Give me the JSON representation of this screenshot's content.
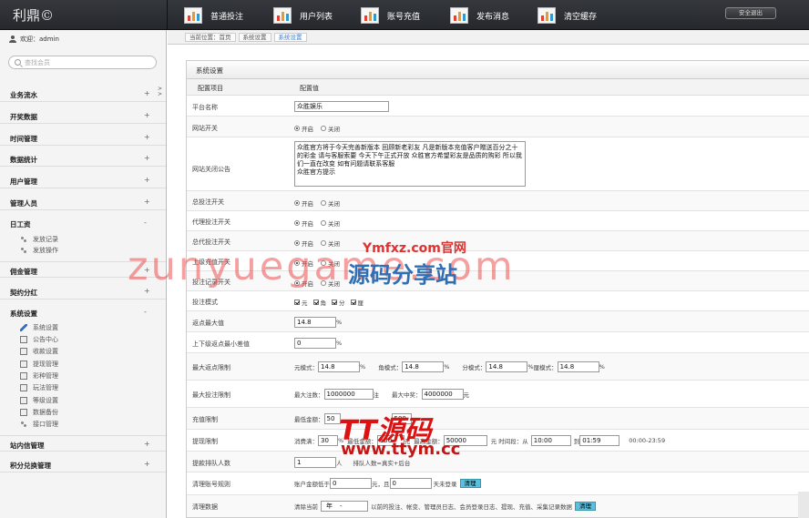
{
  "app": {
    "logo": "利鼎©",
    "logout": "安全退出"
  },
  "nav": [
    {
      "label": "普通投注"
    },
    {
      "label": "用户列表"
    },
    {
      "label": "账号充值"
    },
    {
      "label": "发布消息"
    },
    {
      "label": "清空缓存"
    }
  ],
  "sidebar": {
    "welcome": "欢迎：admin",
    "search_placeholder": "查找会员",
    "sections": [
      {
        "label": "业务流水",
        "toggle": "+"
      },
      {
        "label": "开奖数据",
        "toggle": "+"
      },
      {
        "label": "时间管理",
        "toggle": "+"
      },
      {
        "label": "数据统计",
        "toggle": "+"
      },
      {
        "label": "用户管理",
        "toggle": "+"
      },
      {
        "label": "管理人员",
        "toggle": "+"
      },
      {
        "label": "日工资",
        "toggle": "-"
      },
      {
        "label": "佣金管理",
        "toggle": "+"
      },
      {
        "label": "契约分红",
        "toggle": "+"
      },
      {
        "label": "系统设置",
        "toggle": "-"
      },
      {
        "label": "站内信管理",
        "toggle": "+"
      },
      {
        "label": "积分兑换管理",
        "toggle": "+"
      }
    ],
    "wage_items": [
      "发放记录",
      "发放操作"
    ],
    "system_items": [
      "系统设置",
      "公告中心",
      "收款设置",
      "提现管理",
      "彩种管理",
      "玩法管理",
      "等级设置",
      "数据备份",
      "接口管理"
    ]
  },
  "breadcrumb": {
    "items": [
      "当前位置：首页",
      "系统设置",
      "系统设置"
    ]
  },
  "panel": {
    "title": "系统设置",
    "col1": "配置项目",
    "col2": "配置值"
  },
  "common": {
    "on": "开启",
    "off": "关闭"
  },
  "rows": {
    "site_name": {
      "label": "平台名称",
      "value": "众胜娱乐"
    },
    "site_switch": {
      "label": "网站开关"
    },
    "close_notice": {
      "label": "网站关闭公告",
      "value": "众胜官方将于今天完善新版本 回顾新老彩友 凡是新版本充值客户赠送百分之十的彩金 请与客服索要 今天下午正式开放 众胜官方希望彩友是品质的购彩 所以我们一直在改变 如有问题请联系客服\n众胜官方提示"
    },
    "bet_switch": {
      "label": "总投注开关"
    },
    "agent_bet_switch": {
      "label": "代理投注开关"
    },
    "gen_agent_bet_switch": {
      "label": "总代投注开关"
    },
    "upper_recharge_switch": {
      "label": "上级充值开关"
    },
    "bet_record_switch": {
      "label": "投注记录开关"
    },
    "bet_mode": {
      "label": "投注模式",
      "options": [
        "元",
        "角",
        "分",
        "厘"
      ]
    },
    "rebate_max": {
      "label": "返点最大值",
      "value": "14.8",
      "unit": "%"
    },
    "rebate_min_diff": {
      "label": "上下级返点最小差值",
      "value": "0",
      "unit": "%"
    },
    "max_rebate_limit": {
      "label": "最大返点限制",
      "items": [
        {
          "label": "元模式：",
          "value": "14.8",
          "unit": "%"
        },
        {
          "label": "角模式：",
          "value": "14.8",
          "unit": "%"
        },
        {
          "label": "分模式：",
          "value": "14.8",
          "unit": "%"
        },
        {
          "label": "厘模式：",
          "value": "14.8",
          "unit": "%"
        }
      ]
    },
    "max_bet_limit": {
      "label": "最大投注限制",
      "count_label": "最大注数：",
      "count_value": "1000000",
      "count_unit": "注",
      "prize_label": "最大中奖：",
      "prize_value": "4000000",
      "prize_unit": "元"
    },
    "recharge_limit": {
      "label": "充值限制",
      "min_label": "最低金额：",
      "min_value": "50",
      "max_value": "500"
    },
    "withdraw_limit": {
      "label": "提现限制",
      "full_label": "消费满：",
      "full_value": "30",
      "full_unit": "%",
      "min_label": "最低金额：",
      "min_value": "100",
      "min_unit": "元",
      "max_label": "最高金额：",
      "max_value": "50000",
      "time_label": "元  时间段：从",
      "from": "10:00",
      "to_label": "到",
      "to": "01:59",
      "range": "00:00-23:59"
    },
    "withdraw_queue": {
      "label": "提款排队人数",
      "value": "1",
      "unit": "人",
      "desc": "排队人数=真实+后台"
    },
    "clean_account": {
      "label": "清理账号规则",
      "pre": "账户金额低于",
      "amount": "0",
      "mid": "元，且",
      "days": "0",
      "post": "天未登录",
      "btn": "清理"
    },
    "clean_data": {
      "label": "清理数据",
      "pre": "清除当前",
      "select": "年",
      "post": "以前的投注、帐变、管理员日志、会员登录日志、提现、充值、采集记录数据",
      "btn": "清理"
    }
  },
  "watermarks": {
    "main": "zunyuegame.com",
    "logo2_top": "Ymfxz.com官网",
    "logo2_bottom": "源码分享站",
    "logo3_top": "TT源码",
    "logo3_bottom": "www.ttym.cc"
  },
  "colors": {
    "topbar": "#2d3034",
    "link_blue": "#3a7bd5",
    "button_cyan": "#5bc0de"
  }
}
